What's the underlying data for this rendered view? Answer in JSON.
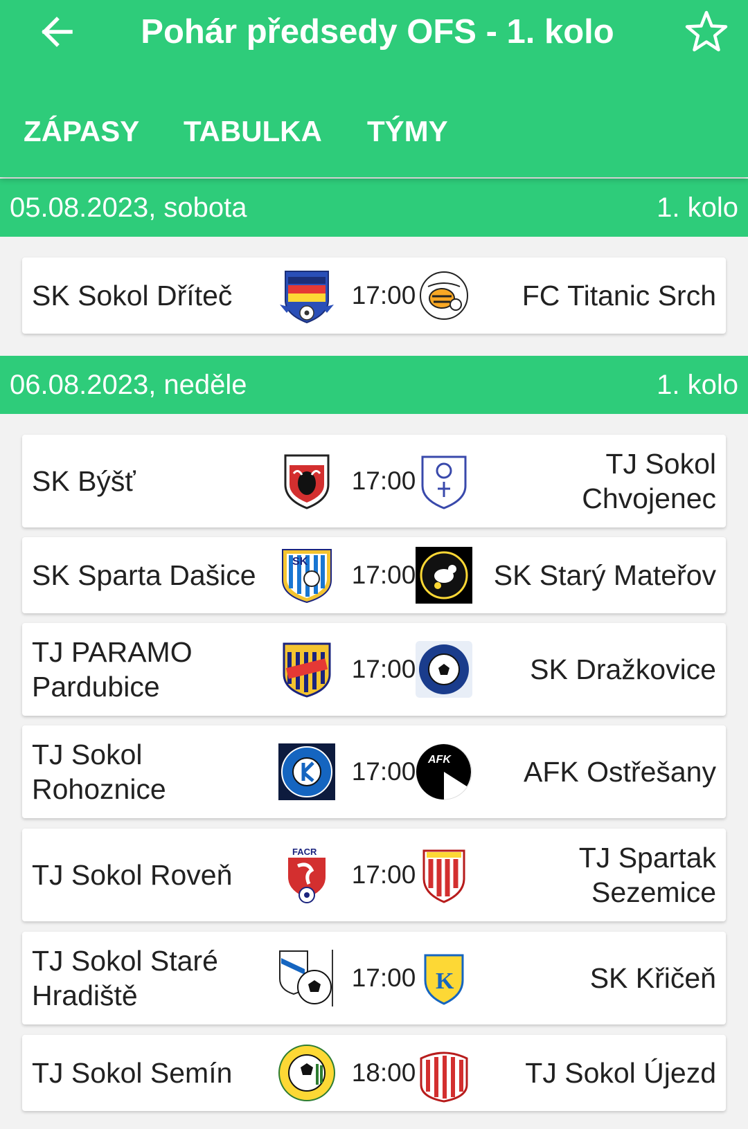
{
  "header": {
    "title": "Pohár předsedy OFS - 1. kolo",
    "tabs": [
      "ZÁPASY",
      "TABULKA",
      "TÝMY"
    ],
    "back_icon": "arrow-left-icon",
    "favorite_icon": "star-outline-icon"
  },
  "colors": {
    "accent": "#2ecc7a",
    "card": "#ffffff",
    "background": "#f2f2f2",
    "text": "#212121"
  },
  "days": [
    {
      "date": "05.08.2023, sobota",
      "round": "1. kolo",
      "matches": [
        {
          "home": "SK Sokol Dříteč",
          "time": "17:00",
          "away": "FC Titanic Srch"
        }
      ]
    },
    {
      "date": "06.08.2023, neděle",
      "round": "1. kolo",
      "matches": [
        {
          "home": "SK Býšť",
          "time": "17:00",
          "away": "TJ Sokol Chvojenec"
        },
        {
          "home": "SK Sparta Dašice",
          "time": "17:00",
          "away": "SK Starý Mateřov"
        },
        {
          "home": "TJ PARAMO Pardubice",
          "time": "17:00",
          "away": "SK Dražkovice"
        },
        {
          "home": "TJ Sokol Rohoznice",
          "time": "17:00",
          "away": "AFK Ostřešany"
        },
        {
          "home": "TJ Sokol Roveň",
          "time": "17:00",
          "away": "TJ Spartak Sezemice"
        },
        {
          "home": "TJ Sokol Staré Hradiště",
          "time": "17:00",
          "away": "SK Křičeň"
        },
        {
          "home": "TJ Sokol Semín",
          "time": "18:00",
          "away": "TJ Sokol Újezd"
        }
      ]
    }
  ]
}
